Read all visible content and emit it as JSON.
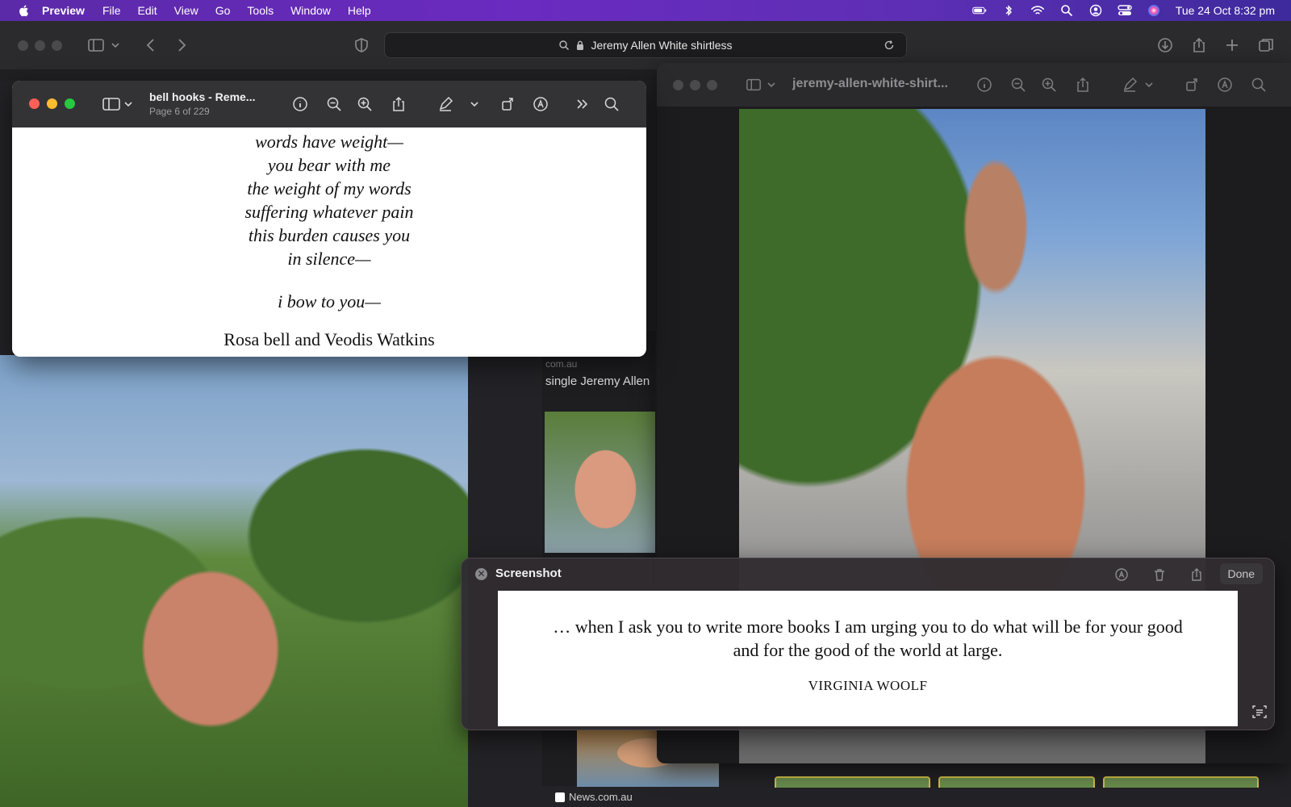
{
  "menubar": {
    "app_name": "Preview",
    "items": [
      "File",
      "Edit",
      "View",
      "Go",
      "Tools",
      "Window",
      "Help"
    ],
    "clock": "Tue 24 Oct  8:32 pm",
    "status_icons": [
      "battery-icon",
      "bluetooth-icon",
      "wifi-icon",
      "spotlight-icon",
      "user-icon",
      "control-center-icon",
      "siri-icon"
    ]
  },
  "safari": {
    "address": "Jeremy Allen White shirtless",
    "result_source": "com.au",
    "result_title": "single Jeremy Allen",
    "bottom_source": "News.com.au"
  },
  "preview_image": {
    "title": "jeremy-allen-white-shirt..."
  },
  "preview_pdf": {
    "title": "bell hooks - Reme...",
    "page_info": "Page 6 of 229",
    "poem_lines": [
      "words have weight—",
      "you bear with me",
      "the weight of my words",
      "suffering whatever pain",
      "this burden causes you",
      "in silence—"
    ],
    "bow_line": "i bow to you—",
    "signature": "Rosa bell and Veodis Watkins"
  },
  "screenshot_panel": {
    "title": "Screenshot",
    "done_label": "Done",
    "quote_line1": "… when I ask you to write more books I am urging you to do what will be for your good",
    "quote_line2": "and for the good of the world at large.",
    "author": "VIRGINIA WOOLF"
  }
}
